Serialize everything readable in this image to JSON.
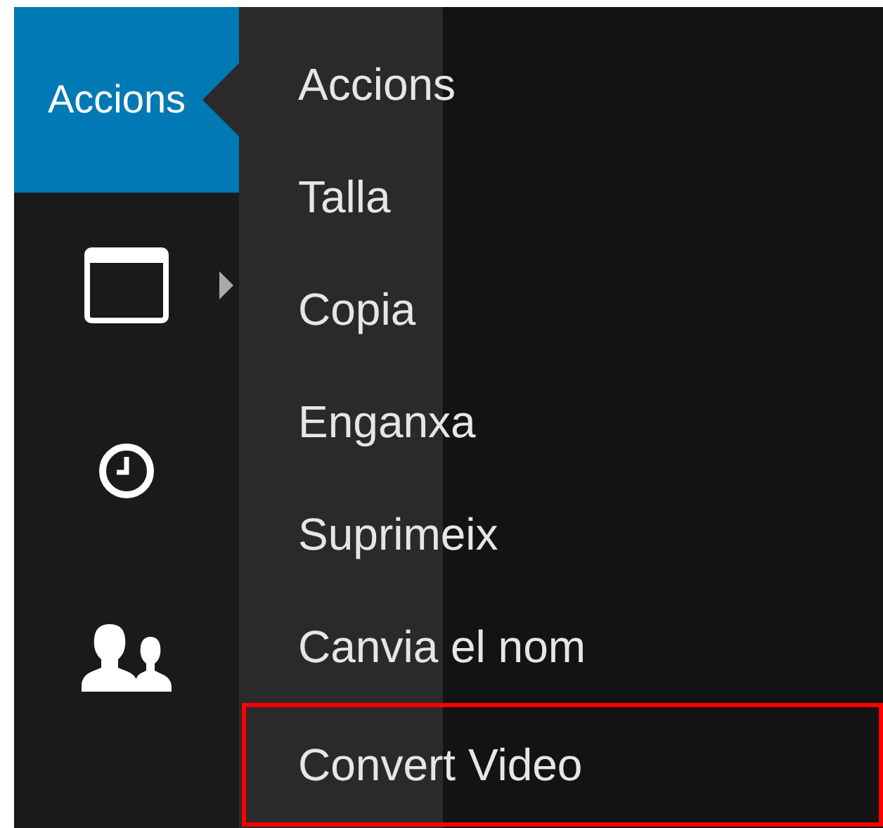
{
  "sidebar": {
    "items": [
      {
        "kind": "text",
        "label": "Accions",
        "selected": true,
        "submenu": false
      },
      {
        "kind": "window",
        "selected": false,
        "submenu": true
      },
      {
        "kind": "clock",
        "selected": false,
        "submenu": false
      },
      {
        "kind": "people",
        "selected": false,
        "submenu": false
      }
    ]
  },
  "menu": {
    "items": [
      {
        "label": "Accions",
        "highlighted": false
      },
      {
        "label": "Talla",
        "highlighted": false
      },
      {
        "label": "Copia",
        "highlighted": false
      },
      {
        "label": "Enganxa",
        "highlighted": false
      },
      {
        "label": "Suprimeix",
        "highlighted": false
      },
      {
        "label": "Canvia el nom",
        "highlighted": false
      },
      {
        "label": "Convert Video",
        "highlighted": true
      }
    ]
  }
}
